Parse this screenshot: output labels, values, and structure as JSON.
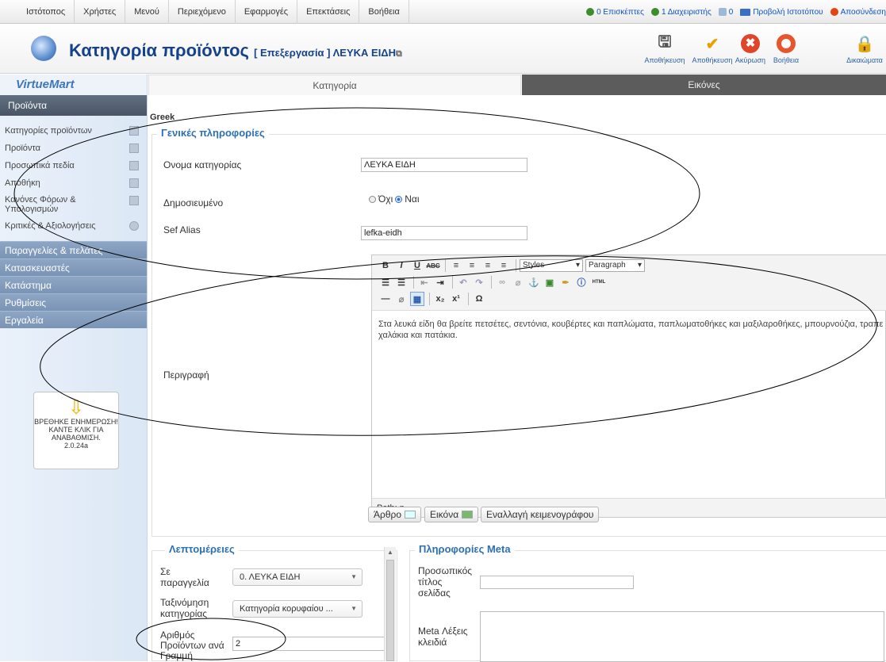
{
  "topbar": {
    "menu": [
      "Ιστότοπος",
      "Χρήστες",
      "Μενού",
      "Περιεχόμενο",
      "Εφαρμογές",
      "Επεκτάσεις",
      "Βοήθεια"
    ],
    "visitors": "0 Επισκέπτες",
    "admins": "1 Διαχειριστής",
    "messages": "0",
    "view_site": "Προβολή Ιστοτόπου",
    "logout": "Αποσύνδεση"
  },
  "header": {
    "title": "Κατηγορία προϊόντος",
    "subtitle": "[ Επεξεργασία ] ΛΕΥΚΑ ΕΙΔΗ",
    "toolbar": {
      "save": "Αποθήκευση",
      "save_close": "Αποθήκευση",
      "cancel": "Ακύρωση",
      "help": "Βοήθεια",
      "permissions": "Δικαιώματα"
    }
  },
  "sidebar": {
    "logo": "VirtueMart",
    "section": "Προϊόντα",
    "items": [
      "Κατηγορίες προϊόντων",
      "Προϊόντα",
      "Προσωπικά πεδία",
      "Αποθήκη",
      "Κανόνες Φόρων & Υπολογισμών",
      "Κριτικές & Αξιολογήσεις"
    ],
    "groups": [
      "Παραγγελίες & πελάτες",
      "Κατασκευαστές",
      "Κατάστημα",
      "Ρυθμίσεις",
      "Εργαλεία"
    ],
    "update_notice": "ΒΡΕΘΗΚΕ ΕΝΗΜΕΡΩΣΗ! ΚΑΝΤΕ ΚΛΙΚ ΓΙΑ ΑΝΑΒΑΘΜΙΣΗ.",
    "version": "2.0.24a"
  },
  "tabs": {
    "category": "Κατηγορία",
    "images": "Εικόνες"
  },
  "language": "Greek",
  "general": {
    "legend": "Γενικές πληροφορίες",
    "name_label": "Ονομα κατηγορίας",
    "name_value": "ΛΕΥΚΑ ΕΙΔΗ",
    "published_label": "Δημοσιευμένο",
    "no": "Όχι",
    "yes": "Ναι",
    "published_value": "yes",
    "alias_label": "Sef Alias",
    "alias_value": "lefka-eidh",
    "description_label": "Περιγραφή"
  },
  "editor": {
    "styles": "Styles",
    "paragraph": "Paragraph",
    "content_line1": "Στα λευκά είδη θα βρείτε πετσέτες, σεντόνια, κουβέρτες και παπλώματα, παπλωματοθήκες και μαξιλαροθήκες, μπουρνούζια, τραπεζομάντηλα,",
    "content_line2": "χαλάκια και πατάκια.",
    "path": "Path: p",
    "btn_article": "Άρθρο",
    "btn_image": "Εικόνα",
    "btn_toggle": "Εναλλαγή κειμενογράφου"
  },
  "details": {
    "legend": "Λεπτομέρειες",
    "order_label": "Σε παραγγελία",
    "order_value": "0. ΛΕΥΚΑ ΕΙΔΗ",
    "sort_label": "Ταξινόμηση κατηγορίας",
    "sort_value": "Κατηγορία κορυφαίου ...",
    "perrow_label": "Αριθμός Προϊόντων ανά Γραμμή",
    "perrow_value": "2"
  },
  "meta": {
    "legend": "Πληροφορίες Meta",
    "title_label": "Προσωπικός τίτλος σελίδας",
    "keywords_label": "Meta Λέξεις κλειδιά"
  },
  "colors": {
    "link": "#0b55c4",
    "title": "#15428b",
    "legend": "#2c70b3",
    "sidebar_group": "#7a94b6"
  }
}
